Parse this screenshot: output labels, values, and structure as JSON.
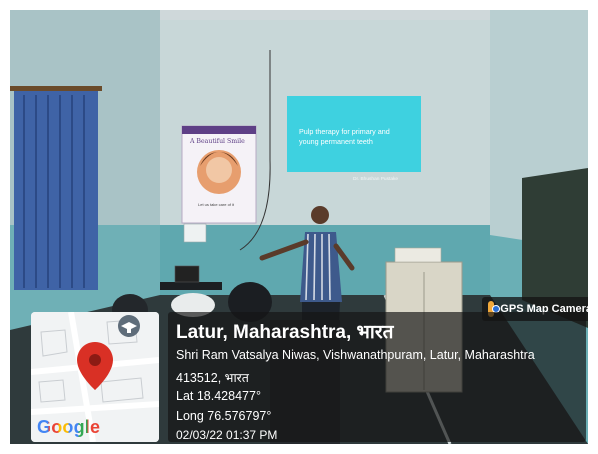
{
  "slide": {
    "title_line1": "Pulp therapy for primary and",
    "title_line2": "young permanent teeth",
    "author": "Dr. Bhushan Pustake"
  },
  "poster": {
    "header": "A Beautiful Smile",
    "caption": "Let us take care of it"
  },
  "gps_tag": {
    "icon": "gps-map-camera-app-icon",
    "label": "GPS Map Camera"
  },
  "map_thumbnail": {
    "logo_text": "Google",
    "pin_color": "#d93025"
  },
  "location": {
    "title": "Latur, Maharashtra, भारत",
    "address_line1": "Shri Ram Vatsalya Niwas, Vishwanathpuram, Latur, Maharashtra",
    "address_line2": "413512, भारत",
    "lat": "Lat 18.428477°",
    "long": "Long 76.576797°",
    "datetime": "02/03/22 01:37 PM"
  }
}
